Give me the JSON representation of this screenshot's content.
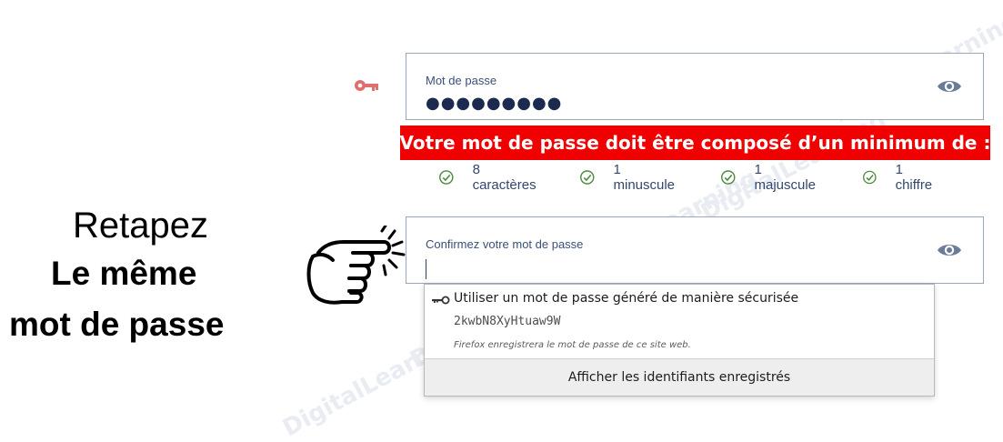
{
  "password_field": {
    "label": "Mot de passe",
    "value": "●●●●●●●●●"
  },
  "requirements": {
    "banner": "Votre mot de passe doit être composé d’un minimum de :",
    "rules": [
      {
        "label": "8 caractères",
        "status": "check-circle-icon"
      },
      {
        "label": "1 minuscule",
        "status": "check-circle-icon"
      },
      {
        "label": "1 majuscule",
        "status": "check-circle-icon"
      },
      {
        "label": "1 chiffre",
        "status": "check-circle-icon"
      }
    ]
  },
  "instruction": {
    "line1": "Retapez",
    "line2": "Le même",
    "line3": "mot de passe"
  },
  "confirm_field": {
    "label": "Confirmez votre mot de passe",
    "value": ""
  },
  "autofill_popup": {
    "title": "Utiliser un mot de passe généré de manière sécurisée",
    "generated_password": "2kwbN8XyHtuaw9W",
    "note": "Firefox enregistrera le mot de passe de ce site web.",
    "footer": "Afficher les identifiants enregistrés"
  },
  "watermark": "DigitalLearning",
  "colors": {
    "banner": "#f00000",
    "field_border": "#9ba8bb",
    "label": "#3a4f7a",
    "check": "#4b8a3c",
    "key_icon": "#e07070",
    "eye_icon": "#6b7c99"
  }
}
